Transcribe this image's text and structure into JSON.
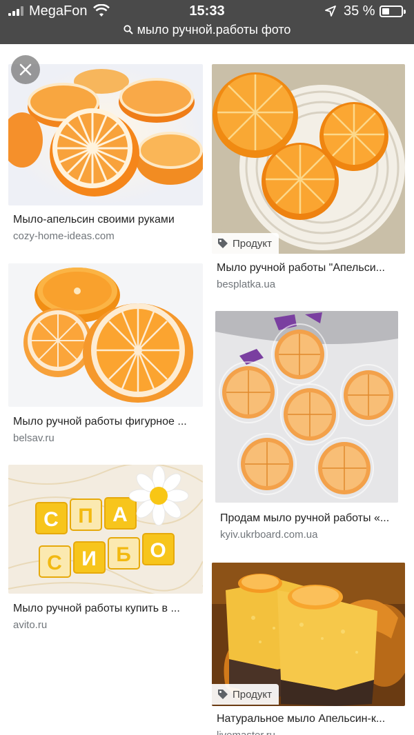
{
  "status_bar": {
    "carrier": "MegaFon",
    "time": "15:33",
    "battery": "35 %",
    "battery_level": 0.35
  },
  "address_bar": {
    "url": "мыло ручной.работы фото"
  },
  "results": [
    {
      "title": "Мыло-апельсин своими руками",
      "source": "cozy-home-ideas.com"
    },
    {
      "title": "Мыло ручной работы \"Апельси...",
      "source": "besplatka.ua",
      "badge": "Продукт"
    },
    {
      "title": "Мыло ручной работы фигурное ...",
      "source": "belsav.ru"
    },
    {
      "title": "Продам мыло ручной работы «...",
      "source": "kyiv.ukrboard.com.ua"
    },
    {
      "title": "Мыло ручной работы купить в ...",
      "source": "avito.ru"
    },
    {
      "title": "Натуральное мыло Апельсин-к...",
      "source": "livemaster.ru",
      "badge": "Продукт"
    }
  ],
  "icons": {
    "close": "close-icon",
    "tag": "tag-icon",
    "search": "search-icon",
    "wifi": "wifi-icon",
    "location": "location-arrow-icon",
    "battery": "battery-icon"
  },
  "colors": {
    "status_bg": "#4a4a4a",
    "orange": "#f39a1e",
    "source_gray": "#70757a"
  }
}
